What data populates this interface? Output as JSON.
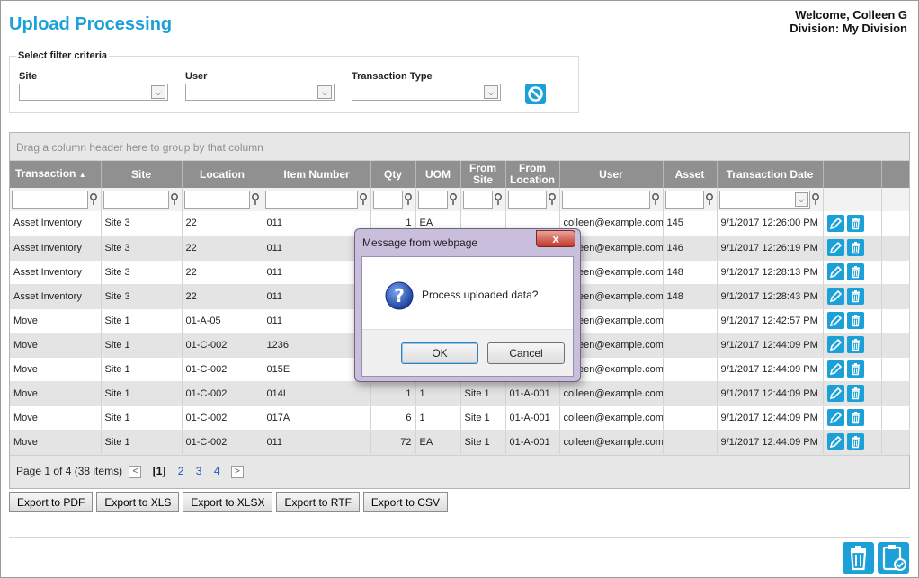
{
  "header": {
    "title": "Upload Processing",
    "welcome": "Welcome, Colleen G",
    "division": "Division: My Division"
  },
  "filters": {
    "legend": "Select filter criteria",
    "site_label": "Site",
    "user_label": "User",
    "type_label": "Transaction Type"
  },
  "grid": {
    "group_hint": "Drag a column header here to group by that column",
    "columns": [
      "Transaction",
      "Site",
      "Location",
      "Item Number",
      "Qty",
      "UOM",
      "From Site",
      "From Location",
      "User",
      "Asset",
      "Transaction Date"
    ],
    "rows": [
      [
        "Asset Inventory",
        "Site 3",
        "22",
        "011",
        "1",
        "EA",
        "",
        "",
        "colleen@example.com",
        "145",
        "9/1/2017 12:26:00 PM"
      ],
      [
        "Asset Inventory",
        "Site 3",
        "22",
        "011",
        "",
        "",
        "",
        "",
        "colleen@example.com",
        "146",
        "9/1/2017 12:26:19 PM"
      ],
      [
        "Asset Inventory",
        "Site 3",
        "22",
        "011",
        "",
        "",
        "",
        "",
        "colleen@example.com",
        "148",
        "9/1/2017 12:28:13 PM"
      ],
      [
        "Asset Inventory",
        "Site 3",
        "22",
        "011",
        "",
        "",
        "",
        "",
        "colleen@example.com",
        "148",
        "9/1/2017 12:28:43 PM"
      ],
      [
        "Move",
        "Site 1",
        "01-A-05",
        "011",
        "",
        "",
        "",
        "",
        "colleen@example.com",
        "",
        "9/1/2017 12:42:57 PM"
      ],
      [
        "Move",
        "Site 1",
        "01-C-002",
        "1236",
        "",
        "",
        "",
        "",
        "colleen@example.com",
        "",
        "9/1/2017 12:44:09 PM"
      ],
      [
        "Move",
        "Site 1",
        "01-C-002",
        "015E",
        "",
        "",
        "",
        "",
        "colleen@example.com",
        "",
        "9/1/2017 12:44:09 PM"
      ],
      [
        "Move",
        "Site 1",
        "01-C-002",
        "014L",
        "1",
        "1",
        "Site 1",
        "01-A-001",
        "colleen@example.com",
        "",
        "9/1/2017 12:44:09 PM"
      ],
      [
        "Move",
        "Site 1",
        "01-C-002",
        "017A",
        "6",
        "1",
        "Site 1",
        "01-A-001",
        "colleen@example.com",
        "",
        "9/1/2017 12:44:09 PM"
      ],
      [
        "Move",
        "Site 1",
        "01-C-002",
        "011",
        "72",
        "EA",
        "Site 1",
        "01-A-001",
        "colleen@example.com",
        "",
        "9/1/2017 12:44:09 PM"
      ]
    ]
  },
  "pager": {
    "summary": "Page 1 of 4 (38 items)",
    "current": "[1]",
    "pages": [
      "2",
      "3",
      "4"
    ],
    "prev": "<",
    "next": ">"
  },
  "exports": [
    "Export to PDF",
    "Export to XLS",
    "Export to XLSX",
    "Export to RTF",
    "Export to CSV"
  ],
  "dialog": {
    "title": "Message from webpage",
    "close": "x",
    "message": "Process uploaded data?",
    "ok": "OK",
    "cancel": "Cancel"
  },
  "colors": {
    "accent": "#1ba1d8",
    "header_bg": "#909090",
    "alt_row": "#e4e4e4"
  },
  "icons": [
    "clear-filter-icon",
    "filter-icon",
    "edit-icon",
    "delete-icon",
    "question-icon",
    "delete-all-icon",
    "process-icon"
  ]
}
